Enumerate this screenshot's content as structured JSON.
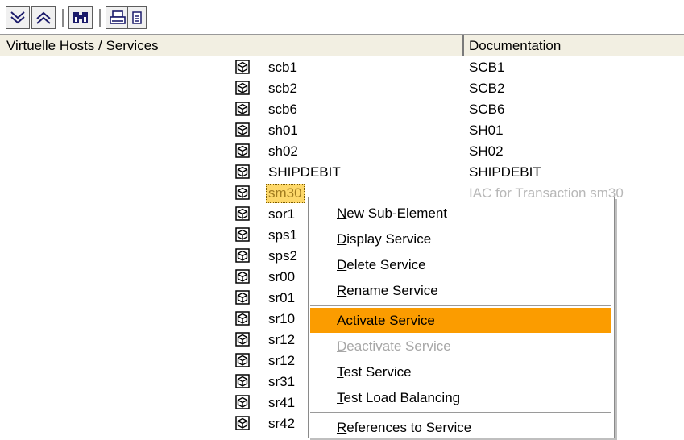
{
  "toolbar": {
    "buttons": [
      {
        "name": "expand-all-button",
        "icon": "expand-all-icon"
      },
      {
        "name": "collapse-all-button",
        "icon": "collapse-all-icon"
      },
      {
        "name": "find-button",
        "icon": "binoculars-icon"
      },
      {
        "name": "print-button",
        "icon": "printer-icon"
      },
      {
        "name": "details-button",
        "icon": "document-icon"
      }
    ]
  },
  "header": {
    "col1": "Virtuelle Hosts / Services",
    "col2": "Documentation"
  },
  "rows": [
    {
      "name": "scb1",
      "doc": "SCB1"
    },
    {
      "name": "scb2",
      "doc": "SCB2"
    },
    {
      "name": "scb6",
      "doc": "SCB6"
    },
    {
      "name": "sh01",
      "doc": "SH01"
    },
    {
      "name": "sh02",
      "doc": "SH02"
    },
    {
      "name": "SHIPDEBIT",
      "doc": "SHIPDEBIT"
    },
    {
      "name": "sm30",
      "doc": "IAC for Transaction sm30"
    },
    {
      "name": "sor1",
      "doc": ""
    },
    {
      "name": "sps1",
      "doc": ""
    },
    {
      "name": "sps2",
      "doc": ""
    },
    {
      "name": "sr00",
      "doc": ""
    },
    {
      "name": "sr01",
      "doc": ""
    },
    {
      "name": "sr10",
      "doc": ""
    },
    {
      "name": "sr12",
      "doc": ""
    },
    {
      "name": "sr12",
      "doc": ""
    },
    {
      "name": "sr31",
      "doc": ""
    },
    {
      "name": "sr41",
      "doc": ""
    },
    {
      "name": "sr42",
      "doc": ""
    }
  ],
  "context_menu": {
    "items": [
      {
        "first": "N",
        "rest": "ew Sub-Element",
        "state": "normal"
      },
      {
        "first": "D",
        "rest": "isplay Service",
        "state": "normal"
      },
      {
        "first": "D",
        "rest": "elete Service",
        "state": "normal"
      },
      {
        "first": "R",
        "rest": "ename Service",
        "state": "normal"
      },
      {
        "first": "A",
        "rest": "ctivate Service",
        "state": "highlighted"
      },
      {
        "first": "D",
        "rest": "eactivate Service",
        "state": "disabled"
      },
      {
        "first": "T",
        "rest": "est Service",
        "state": "normal"
      },
      {
        "first": "T",
        "rest": "est Load Balancing",
        "state": "normal"
      },
      {
        "first": "R",
        "rest": "eferences to Service",
        "state": "normal"
      }
    ]
  },
  "colors": {
    "highlight": "#fb9c00",
    "selection": "#fdd86a",
    "header_bg": "#f2efe2"
  }
}
